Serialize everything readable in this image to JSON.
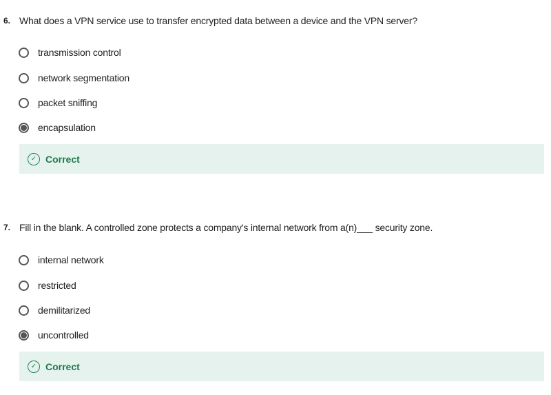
{
  "questions": [
    {
      "number": "6.",
      "text": "What does a VPN service use to transfer encrypted data between a device and the VPN server?",
      "options": [
        "transmission control",
        "network segmentation",
        "packet sniffing",
        "encapsulation"
      ],
      "selected": 3,
      "feedback": "Correct",
      "feedback_icon": "check-circle-icon"
    },
    {
      "number": "7.",
      "text": "Fill in the blank. A controlled zone protects a company's internal network from a(n)___ security zone.",
      "options": [
        "internal network",
        "restricted",
        "demilitarized",
        "uncontrolled"
      ],
      "selected": 3,
      "feedback": "Correct",
      "feedback_icon": "check-circle-icon"
    }
  ],
  "colors": {
    "correct": "#1f7a4d",
    "feedback_bg": "#e6f2ee"
  }
}
